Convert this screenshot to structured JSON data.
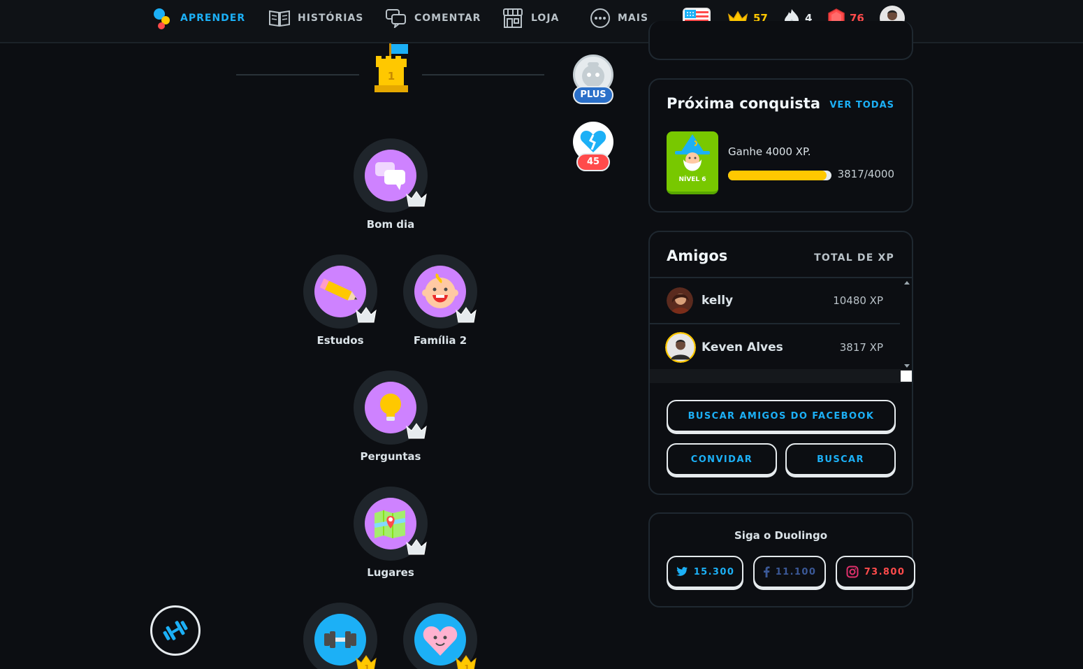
{
  "nav": {
    "learn": "APRENDER",
    "stories": "HISTÓRIAS",
    "discuss": "COMENTAR",
    "shop": "LOJA",
    "more": "MAIS"
  },
  "stats": {
    "crowns": "57",
    "streak": "4",
    "gems": "76"
  },
  "colors": {
    "accent": "#1cb0f6",
    "crown": "#ffc800",
    "gems": "#ff4b4b",
    "skill_purple": "#ce82ff",
    "skill_blue": "#1cb0f6"
  },
  "path": {
    "checkpoint_number": "1",
    "plus_badge": "PLUS",
    "hearts_badge": "45",
    "skills": [
      {
        "label": "Bom dia",
        "icon": "chat-bubbles-icon"
      },
      {
        "label": "Estudos",
        "icon": "pencil-icon"
      },
      {
        "label": "Família 2",
        "icon": "baby-icon"
      },
      {
        "label": "Perguntas",
        "icon": "lightbulb-icon"
      },
      {
        "label": "Lugares",
        "icon": "map-icon"
      },
      {
        "label": "",
        "icon": "dumbbell-icon",
        "crown_level": "1"
      },
      {
        "label": "",
        "icon": "heart-face-icon",
        "crown_level": "1"
      }
    ]
  },
  "achievement": {
    "title": "Próxima conquista",
    "see_all": "VER TODAS",
    "badge_level": "NÍVEL 6",
    "description": "Ganhe 4000 XP.",
    "progress_text": "3817/4000",
    "progress_fraction": 0.954
  },
  "friends": {
    "title": "Amigos",
    "column": "TOTAL DE XP",
    "list": [
      {
        "name": "kelly",
        "xp": "10480 XP"
      },
      {
        "name": "Keven Alves",
        "xp": "3817 XP"
      }
    ],
    "facebook_button": "BUSCAR AMIGOS DO FACEBOOK",
    "invite_button": "CONVIDAR",
    "search_button": "BUSCAR"
  },
  "social": {
    "title": "Siga o Duolingo",
    "twitter": "15.300",
    "facebook": "11.100",
    "instagram": "73.800"
  }
}
